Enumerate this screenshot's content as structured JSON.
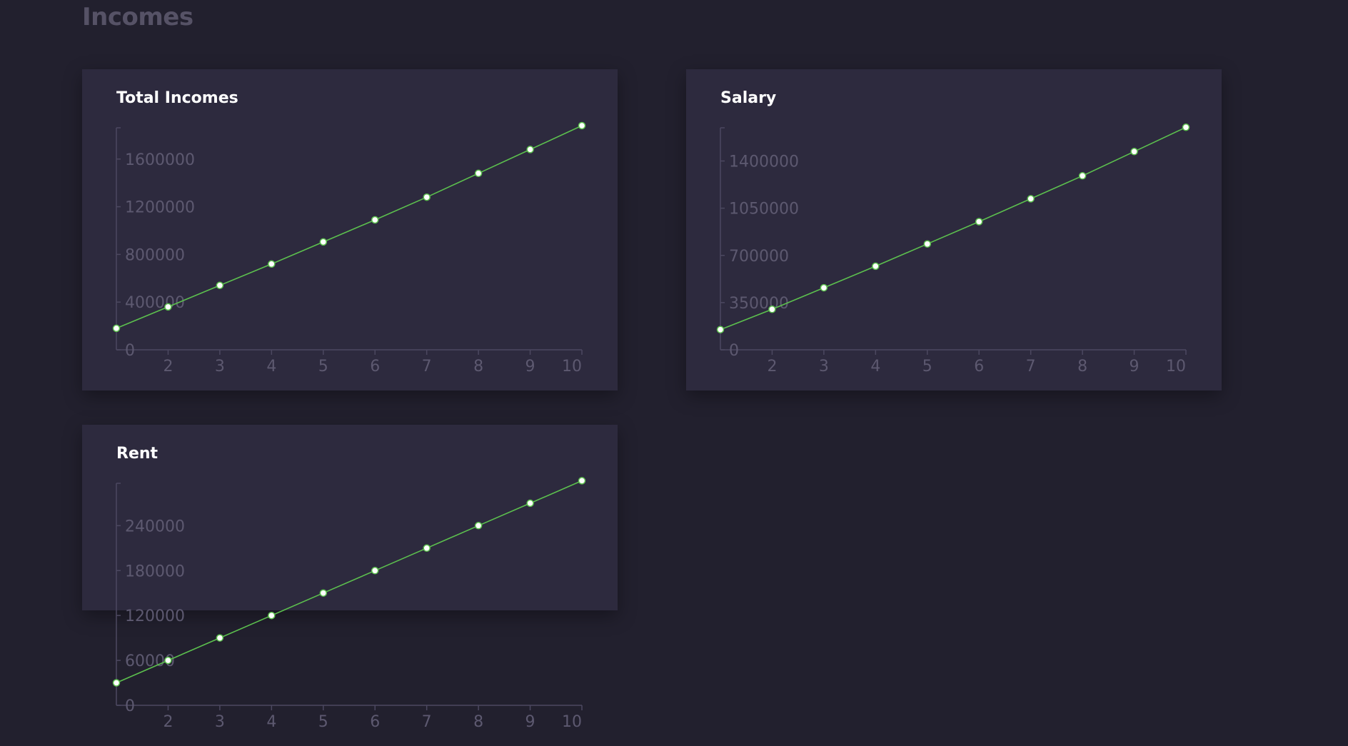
{
  "page": {
    "title": "Incomes"
  },
  "chart_data": [
    {
      "type": "line",
      "title": "Total Incomes",
      "x": [
        1,
        2,
        3,
        4,
        5,
        6,
        7,
        8,
        9,
        10
      ],
      "series": [
        {
          "values": [
            180000,
            360000,
            540000,
            720000,
            905000,
            1090000,
            1280000,
            1480000,
            1680000,
            1880000
          ],
          "color": "#5cc04e"
        }
      ],
      "x_ticks": [
        2,
        3,
        4,
        5,
        6,
        7,
        8,
        9,
        10
      ],
      "y_ticks": [
        0,
        400000,
        800000,
        1200000,
        1600000
      ],
      "xlim": [
        1,
        10
      ],
      "ylim": [
        0,
        1940000
      ],
      "grid": false
    },
    {
      "type": "line",
      "title": "Salary",
      "x": [
        1,
        2,
        3,
        4,
        5,
        6,
        7,
        8,
        9,
        10
      ],
      "series": [
        {
          "values": [
            150000,
            300000,
            460000,
            620000,
            785000,
            950000,
            1120000,
            1290000,
            1470000,
            1650000
          ],
          "color": "#5cc04e"
        }
      ],
      "x_ticks": [
        2,
        3,
        4,
        5,
        6,
        7,
        8,
        9,
        10
      ],
      "y_ticks": [
        0,
        350000,
        700000,
        1050000,
        1400000
      ],
      "xlim": [
        1,
        10
      ],
      "ylim": [
        0,
        1715000
      ],
      "grid": false
    },
    {
      "type": "line",
      "title": "Rent",
      "x": [
        1,
        2,
        3,
        4,
        5,
        6,
        7,
        8,
        9,
        10
      ],
      "series": [
        {
          "values": [
            30000,
            60000,
            90000,
            120000,
            150000,
            180000,
            210000,
            240000,
            270000,
            300000
          ],
          "color": "#5cc04e"
        }
      ],
      "x_ticks": [
        2,
        3,
        4,
        5,
        6,
        7,
        8,
        9,
        10
      ],
      "y_ticks": [
        0,
        60000,
        120000,
        180000,
        240000
      ],
      "xlim": [
        1,
        10
      ],
      "ylim": [
        0,
        309000
      ],
      "grid": false
    }
  ]
}
